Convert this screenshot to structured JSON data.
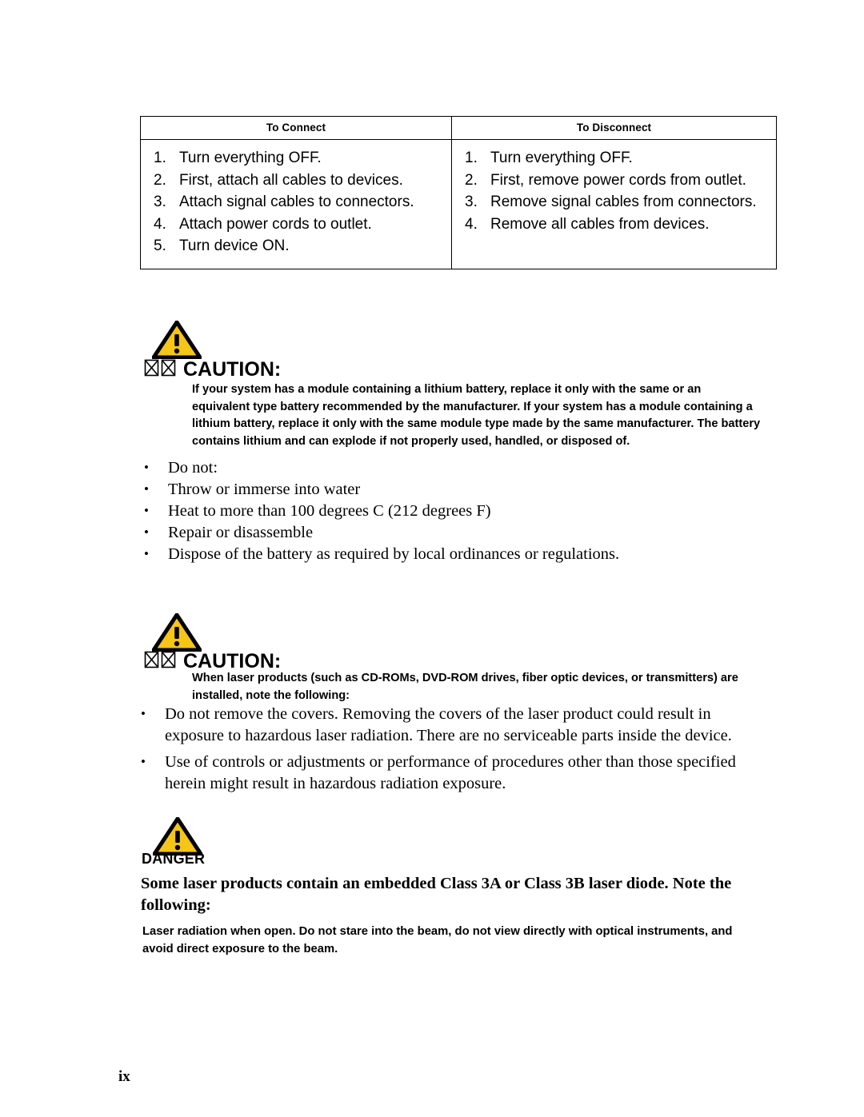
{
  "page": {
    "number": "ix",
    "accent_yellow": "#F5C518",
    "ink": "#000000",
    "paper": "#FFFFFF"
  },
  "connect_table": {
    "headers": [
      "To Connect",
      "To Disconnect"
    ],
    "connect_steps": [
      {
        "num": "1.",
        "text": "Turn everything OFF."
      },
      {
        "num": "2.",
        "text": "First, attach all cables to devices."
      },
      {
        "num": "3.",
        "text": "Attach signal cables to connectors."
      },
      {
        "num": "4.",
        "text": "Attach power cords to outlet."
      },
      {
        "num": "5.",
        "text": "Turn device ON."
      }
    ],
    "disconnect_steps": [
      {
        "num": "1.",
        "text": "Turn everything OFF."
      },
      {
        "num": "2.",
        "text": "First, remove power cords from outlet."
      },
      {
        "num": "3.",
        "text": "Remove signal cables from connectors."
      },
      {
        "num": "4.",
        "text": "Remove all cables from devices."
      }
    ]
  },
  "caution_battery": {
    "label": "CAUTION:",
    "body": "If your system has a module containing a lithium battery, replace it only with the same or an equivalent type battery recommended by the manufacturer. If your system has a module containing a lithium battery, replace it only with the same module type made by the same manufacturer. The battery contains lithium and can explode if not properly used, handled, or disposed of.",
    "bullets": [
      "Do not:",
      "Throw or immerse into water",
      "Heat to more than 100 degrees C (212 degrees F)",
      "Repair or disassemble",
      "Dispose of the battery as required by local ordinances or regulations."
    ]
  },
  "caution_laser": {
    "label": "CAUTION:",
    "body": "When laser products (such as CD-ROMs, DVD-ROM drives, fiber optic devices, or transmitters) are installed, note the following:",
    "bullets": [
      "Do not remove the covers. Removing the covers of the laser product could result in exposure to hazardous laser radiation. There are no serviceable parts inside the device.",
      "Use of controls or adjustments or performance of procedures other than those specified herein might result in hazardous radiation exposure."
    ]
  },
  "danger": {
    "label": "DANGER",
    "lead": "Some laser products contain an embedded Class 3A or Class 3B laser diode. Note the following:",
    "note": "Laser radiation when open. Do not stare into the beam, do not view directly with optical instruments, and avoid direct exposure to the beam."
  },
  "glyphs": {
    "bullet": "•"
  }
}
